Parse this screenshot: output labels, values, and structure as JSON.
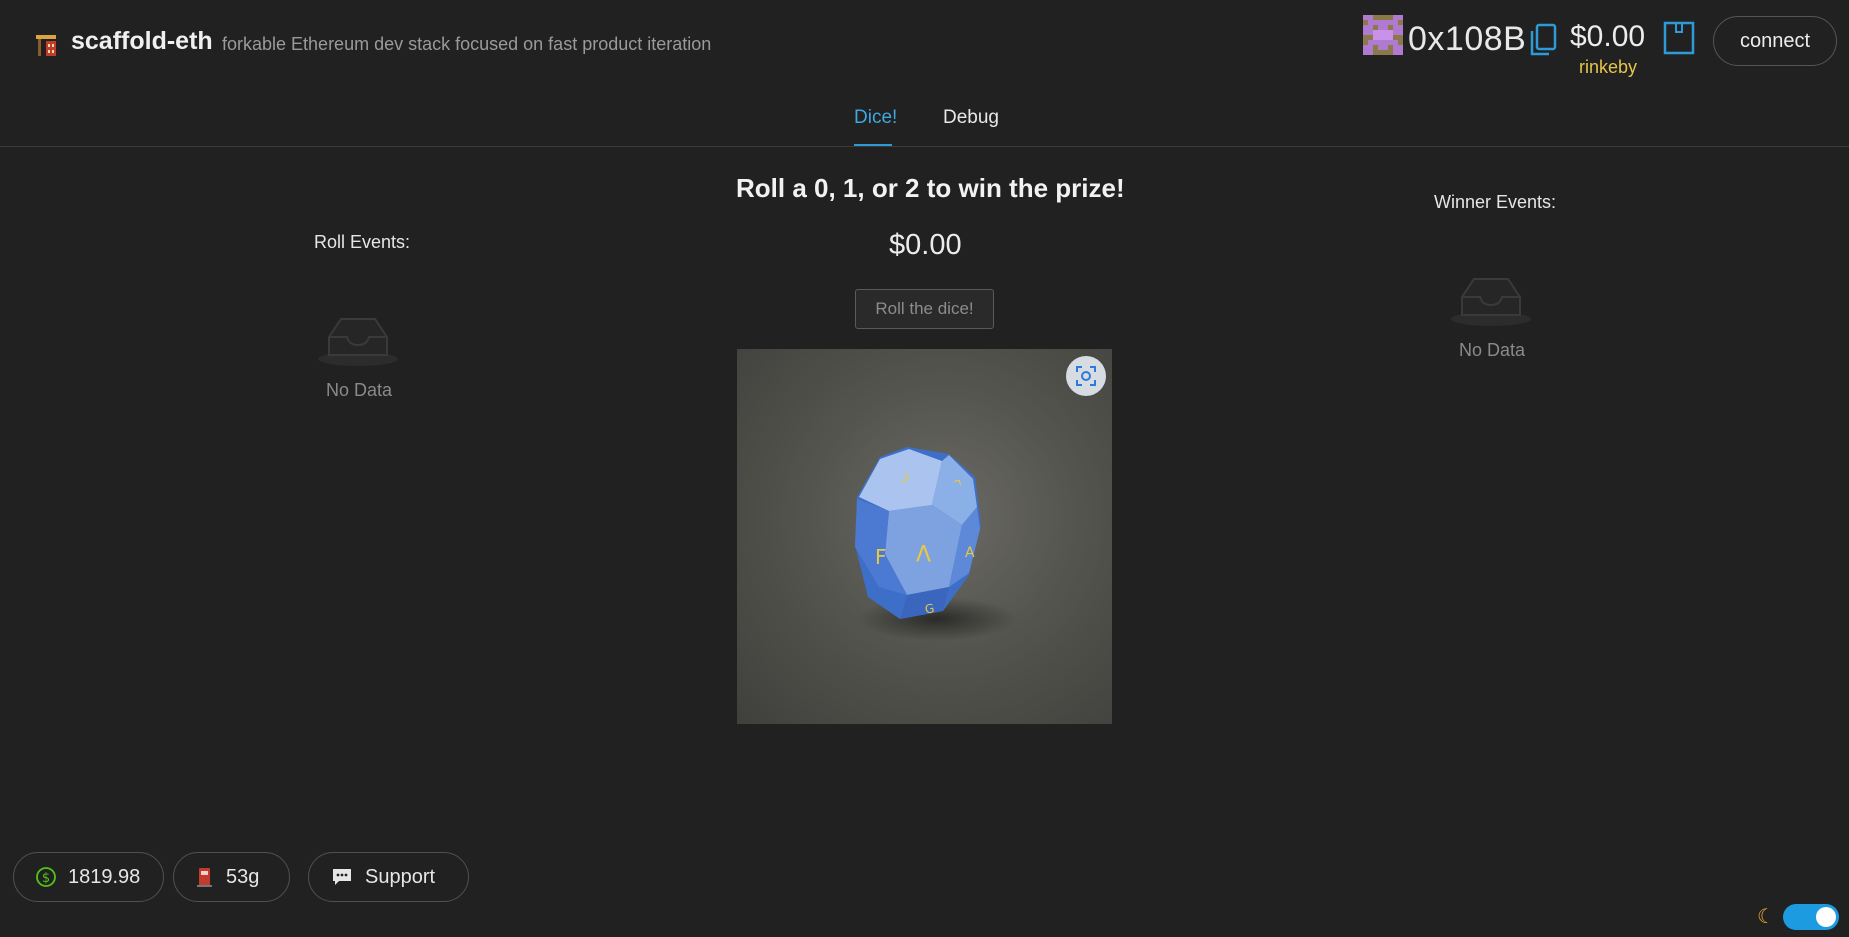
{
  "header": {
    "title": "scaffold-eth",
    "subtitle": "forkable Ethereum dev stack focused on fast product iteration"
  },
  "account": {
    "address": "0x108B",
    "balance": "$0.00",
    "network": "rinkeby",
    "connect_label": "connect"
  },
  "tabs": [
    {
      "label": "Dice!",
      "active": true
    },
    {
      "label": "Debug",
      "active": false
    }
  ],
  "main": {
    "heading": "Roll a 0, 1, or 2 to win the prize!",
    "prize": "$0.00",
    "roll_button": "Roll the dice!"
  },
  "roll_events": {
    "label": "Roll Events:",
    "empty_text": "No Data"
  },
  "winner_events": {
    "label": "Winner Events:",
    "empty_text": "No Data"
  },
  "footer": {
    "eth_price": "1819.98",
    "gas_price": "53g",
    "support_label": "Support"
  },
  "colors": {
    "background": "#212121",
    "accent": "#2e9ad8",
    "network": "#e6c64a",
    "dice_blue": "#3e6fc8"
  },
  "icons": [
    "scaffold-logo-icon",
    "blockie-avatar",
    "copy-icon",
    "wallet-icon",
    "empty-inbox-icon",
    "image-preview-icon",
    "dollar-icon",
    "gas-pump-icon",
    "chat-icon",
    "moon-icon"
  ]
}
